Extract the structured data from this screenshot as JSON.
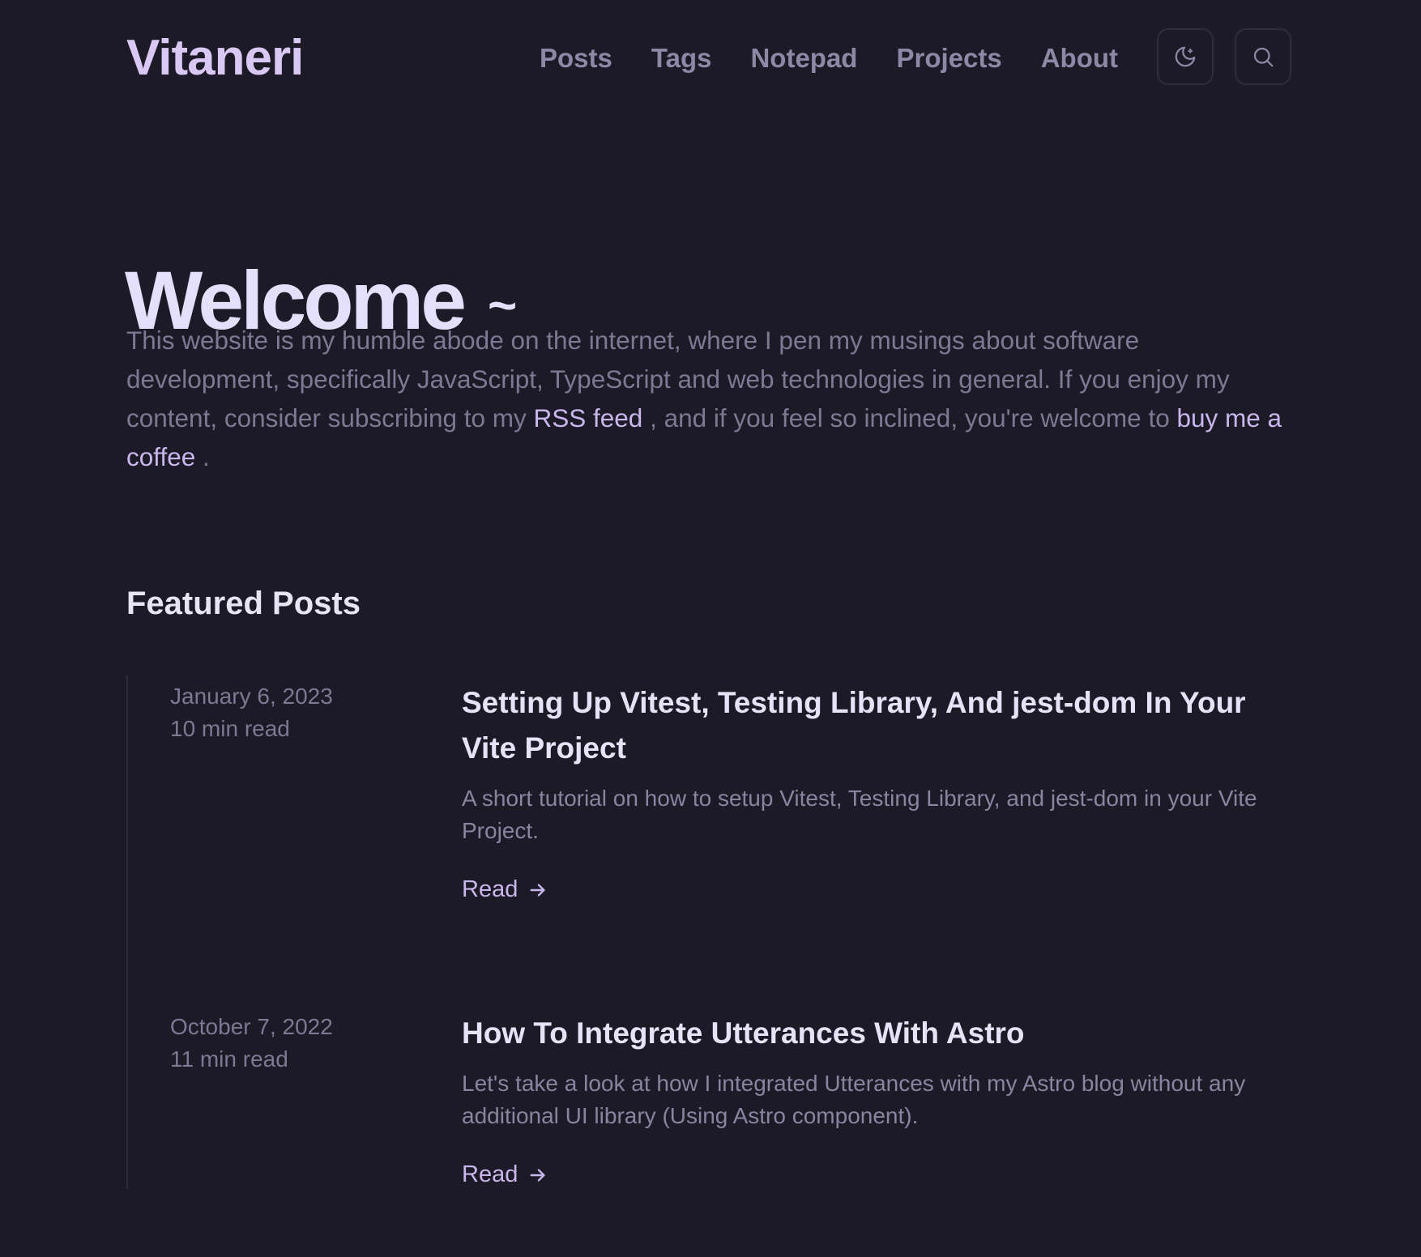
{
  "site": {
    "logo": "Vitaneri"
  },
  "nav": {
    "items": [
      {
        "label": "Posts"
      },
      {
        "label": "Tags"
      },
      {
        "label": "Notepad"
      },
      {
        "label": "Projects"
      },
      {
        "label": "About"
      }
    ],
    "theme_toggle_icon": "moon-icon",
    "search_icon": "search-icon"
  },
  "hero": {
    "title": "Welcome",
    "tilde": "~",
    "intro_part1": "This website is my humble abode on the internet, where I pen my musings about software development, specifically JavaScript, TypeScript and web technologies in general. If you enjoy my content, consider subscribing to my ",
    "rss_link": "RSS feed",
    "intro_part2": " , and if you feel so inclined, you're welcome to ",
    "coffee_link": "buy me a coffee",
    "intro_part3": " ."
  },
  "featured": {
    "title": "Featured Posts",
    "posts": [
      {
        "date": "January 6, 2023",
        "read_time": "10 min read",
        "title": "Setting Up Vitest, Testing Library, And jest-dom In Your Vite Project",
        "description": "A short tutorial on how to setup Vitest, Testing Library, and jest-dom in your Vite Project.",
        "read_label": "Read"
      },
      {
        "date": "October 7, 2022",
        "read_time": "11 min read",
        "title": "How To Integrate Utterances With Astro",
        "description": "Let's take a look at how I integrated Utterances with my Astro blog without any additional UI library (Using Astro component).",
        "read_label": "Read"
      }
    ]
  },
  "colors": {
    "background": "#1b1a26",
    "accent": "#c9b6ec",
    "muted_text": "#7e7894",
    "heading_text": "#e4e0fb"
  }
}
